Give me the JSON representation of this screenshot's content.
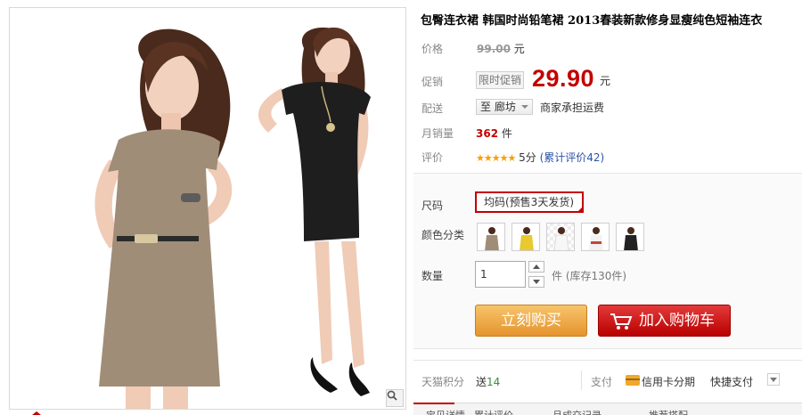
{
  "product": {
    "title": "包臀连衣裙 韩国时尚铅笔裙 2013春装新款修身显瘦纯色短袖连衣"
  },
  "price": {
    "label": "价格",
    "original": "99.00",
    "unit": "元"
  },
  "promo": {
    "label": "促销",
    "tag": "限时促销",
    "price": "29.90",
    "unit": "元"
  },
  "shipping": {
    "label": "配送",
    "destination": "至 廊坊",
    "note": "商家承担运费"
  },
  "sales": {
    "label": "月销量",
    "count": "362",
    "unit": "件"
  },
  "rating": {
    "label": "评价",
    "stars": "★★★★★",
    "score": "5分",
    "reviews_link": "(累计评价42)"
  },
  "options": {
    "size_label": "尺码",
    "size_value": "均码(预售3天发货)",
    "color_label": "颜色分类",
    "swatches": [
      {
        "name": "khaki",
        "color": "#a08d78"
      },
      {
        "name": "yellow",
        "color": "#e8c92e"
      },
      {
        "name": "white",
        "color": "#f2f2f2"
      },
      {
        "name": "red",
        "color": "#c0473c"
      },
      {
        "name": "black",
        "color": "#222222"
      }
    ],
    "qty_label": "数量",
    "qty_value": "1",
    "stock_text": "件 (库存130件)"
  },
  "actions": {
    "buy_now": "立刻购买",
    "add_to_cart": "加入购物车"
  },
  "footer": {
    "points_label": "天猫积分",
    "points_prefix": "送",
    "points_value": "14",
    "pay_label": "支付",
    "credit_card": "信用卡分期",
    "quick_pay": "快捷支付"
  },
  "tabs": [
    "宝贝详情",
    "累计评价",
    "月成交记录",
    "推荐搭配"
  ],
  "colors": {
    "accent_red": "#c40000",
    "buy_orange": "#e5942e",
    "cart_red": "#b80000",
    "link_blue": "#2953a6",
    "star_gold": "#f5a000"
  }
}
